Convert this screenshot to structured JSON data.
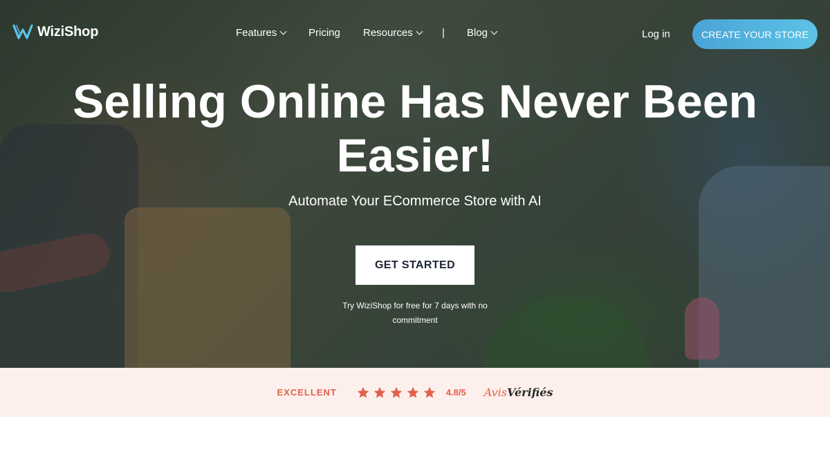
{
  "brand": {
    "name": "WiziShop",
    "logo_icon": "w-logo-icon",
    "accent": "#4aa3d6"
  },
  "nav": {
    "items": [
      {
        "label": "Features",
        "has_dropdown": true
      },
      {
        "label": "Pricing",
        "has_dropdown": false
      },
      {
        "label": "Resources",
        "has_dropdown": true
      },
      {
        "label": "Blog",
        "has_dropdown": true
      }
    ],
    "separator": "|",
    "login_label": "Log in",
    "cta_label": "CREATE YOUR STORE"
  },
  "hero": {
    "headline": "Selling Online Has Never Been Easier!",
    "subhead": "Automate Your ECommerce Store with AI",
    "button_label": "GET STARTED",
    "trial_text": "Try WiziShop for free for 7 days with no commitment"
  },
  "rating": {
    "label": "EXCELLENT",
    "stars": 5,
    "star_color": "#e2614a",
    "score": "4.8/5",
    "provider_part1": "Avis",
    "provider_part2": "Vérifiés"
  }
}
